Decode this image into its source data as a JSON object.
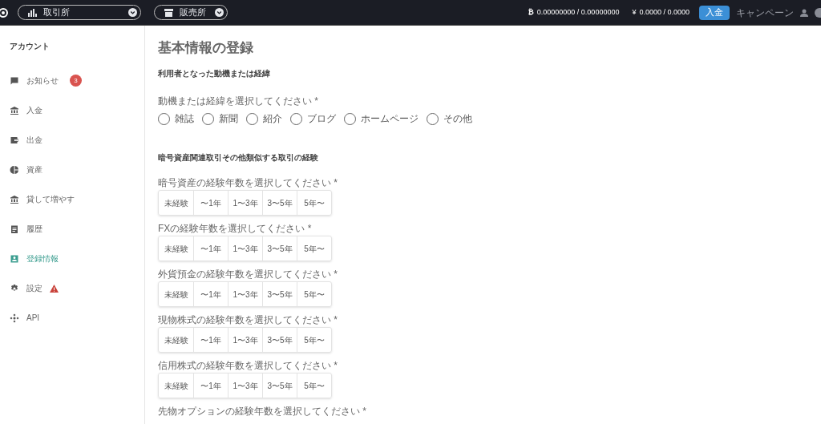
{
  "topbar": {
    "selectors": [
      {
        "label": "取引所",
        "kind": "chart"
      },
      {
        "label": "販売所",
        "kind": "store"
      }
    ],
    "btc_balance": "0.00000000 / 0.00000000",
    "btc_symbol": "₿",
    "jpy_symbol": "¥",
    "jpy_balance": "0.0000 / 0.0000",
    "deposit_button": "入金",
    "campaign_link": "キャンペーン"
  },
  "sidebar": {
    "heading": "アカウント",
    "items": [
      {
        "label": "お知らせ",
        "kind": "message",
        "selected": false,
        "badge": "3"
      },
      {
        "label": "入金",
        "kind": "bank",
        "selected": false
      },
      {
        "label": "出金",
        "kind": "wallet",
        "selected": false
      },
      {
        "label": "資産",
        "kind": "pie",
        "selected": false
      },
      {
        "label": "貸して増やす",
        "kind": "bank",
        "selected": false
      },
      {
        "label": "履歴",
        "kind": "clipboard",
        "selected": false
      },
      {
        "label": "登録情報",
        "kind": "contact",
        "selected": true
      },
      {
        "label": "設定",
        "kind": "gear",
        "selected": false,
        "warning": true
      },
      {
        "label": "API",
        "kind": "api",
        "selected": false
      }
    ]
  },
  "main": {
    "title": "基本情報の登録",
    "section_1": {
      "heading": "利用者となった動機または経緯",
      "label": "動機または経緯を選択してください *",
      "options": [
        {
          "label": "雑誌",
          "selected": false
        },
        {
          "label": "新聞",
          "selected": false
        },
        {
          "label": "紹介",
          "selected": false
        },
        {
          "label": "ブログ",
          "selected": false
        },
        {
          "label": "ホームページ",
          "selected": false
        },
        {
          "label": "その他",
          "selected": false
        }
      ]
    },
    "section_2": {
      "heading": "暗号資産関連取引その他類似する取引の経験",
      "questions": [
        {
          "label": "暗号資産の経験年数を選択してください *",
          "options": [
            {
              "label": "未経験",
              "selected": false
            },
            {
              "label": "〜1年",
              "selected": false
            },
            {
              "label": "1〜3年",
              "selected": false
            },
            {
              "label": "3〜5年",
              "selected": false
            },
            {
              "label": "5年〜",
              "selected": false
            }
          ]
        },
        {
          "label": "FXの経験年数を選択してください *",
          "options": [
            {
              "label": "未経験",
              "selected": false
            },
            {
              "label": "〜1年",
              "selected": false
            },
            {
              "label": "1〜3年",
              "selected": false
            },
            {
              "label": "3〜5年",
              "selected": false
            },
            {
              "label": "5年〜",
              "selected": false
            }
          ]
        },
        {
          "label": "外貨預金の経験年数を選択してください *",
          "options": [
            {
              "label": "未経験",
              "selected": false
            },
            {
              "label": "〜1年",
              "selected": false
            },
            {
              "label": "1〜3年",
              "selected": false
            },
            {
              "label": "3〜5年",
              "selected": false
            },
            {
              "label": "5年〜",
              "selected": false
            }
          ]
        },
        {
          "label": "現物株式の経験年数を選択してください *",
          "options": [
            {
              "label": "未経験",
              "selected": false
            },
            {
              "label": "〜1年",
              "selected": false
            },
            {
              "label": "1〜3年",
              "selected": false
            },
            {
              "label": "3〜5年",
              "selected": false
            },
            {
              "label": "5年〜",
              "selected": false
            }
          ]
        },
        {
          "label": "信用株式の経験年数を選択してください *",
          "options": [
            {
              "label": "未経験",
              "selected": false
            },
            {
              "label": "〜1年",
              "selected": false
            },
            {
              "label": "1〜3年",
              "selected": false
            },
            {
              "label": "3〜5年",
              "selected": false
            },
            {
              "label": "5年〜",
              "selected": false
            }
          ]
        },
        {
          "label": "先物オプションの経験年数を選択してください *"
        }
      ]
    }
  }
}
